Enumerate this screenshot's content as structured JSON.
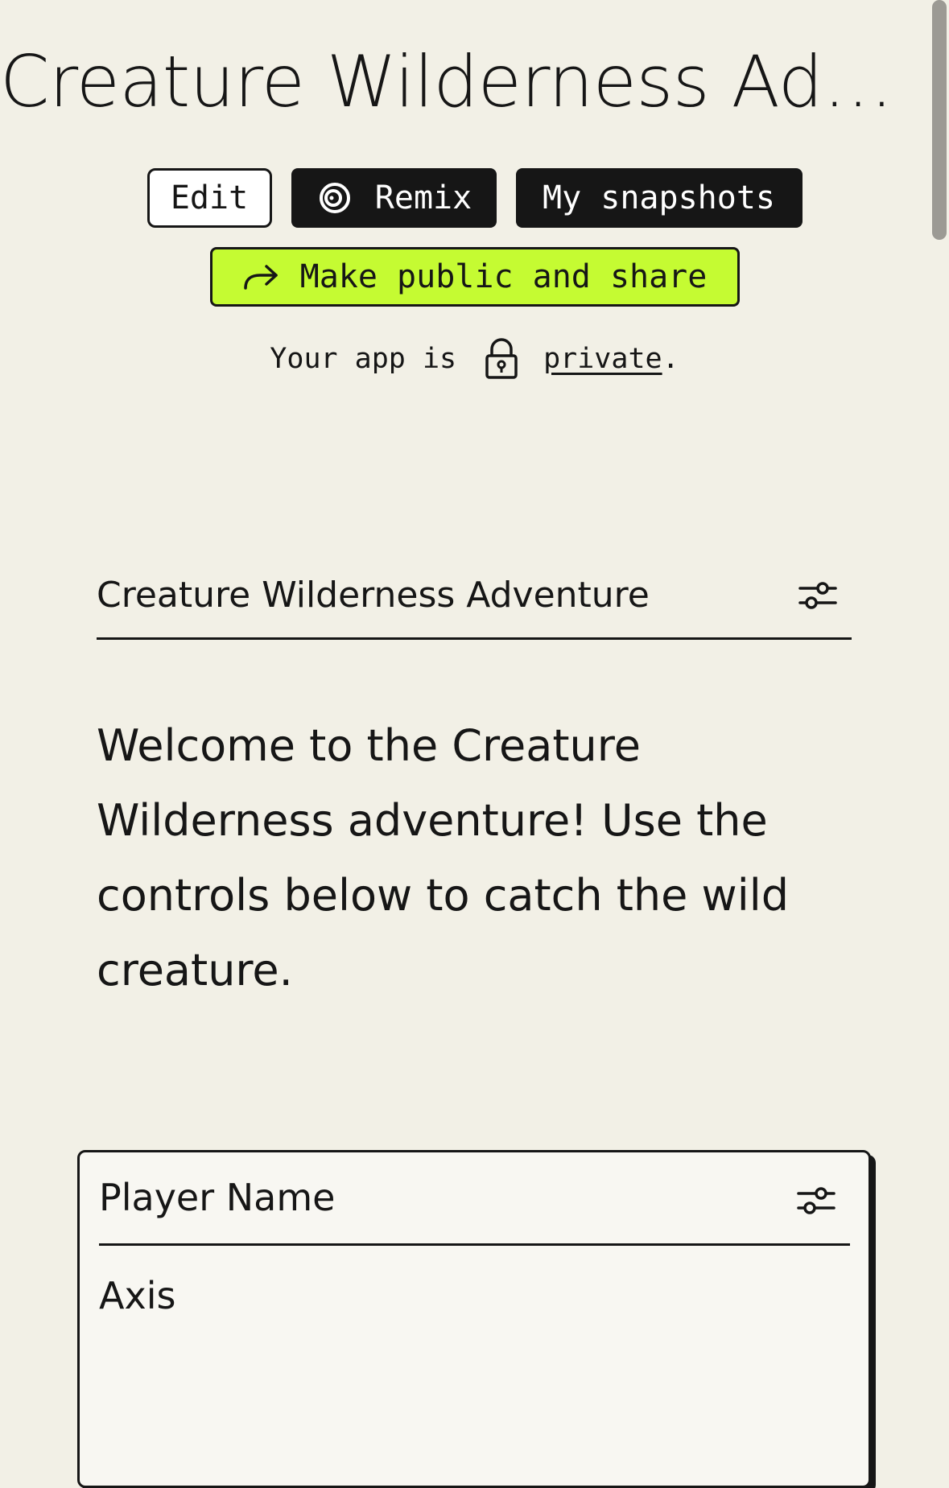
{
  "header": {
    "title": "Creature Wilderness Adventure"
  },
  "toolbar": {
    "edit_label": "Edit",
    "remix_label": "Remix",
    "snapshots_label": "My snapshots",
    "share_label": "Make public and share",
    "share_button_color": "#c5fb32",
    "remix_icon": "remix-rings-icon",
    "share_icon": "arrow-right-icon"
  },
  "privacy": {
    "prefix": "Your app is",
    "link_label": "private",
    "suffix": ".",
    "icon": "lock-icon"
  },
  "app": {
    "header_title": "Creature Wilderness Adventure",
    "settings_icon": "sliders-icon",
    "welcome": "Welcome to the Creature Wilderness adventure! Use the controls below to catch the wild creature."
  },
  "player_card": {
    "title": "Player Name",
    "value": "Axis",
    "settings_icon": "sliders-icon"
  },
  "colors": {
    "background": "#f2f0e6",
    "ink": "#161616",
    "accent": "#c5fb32"
  }
}
